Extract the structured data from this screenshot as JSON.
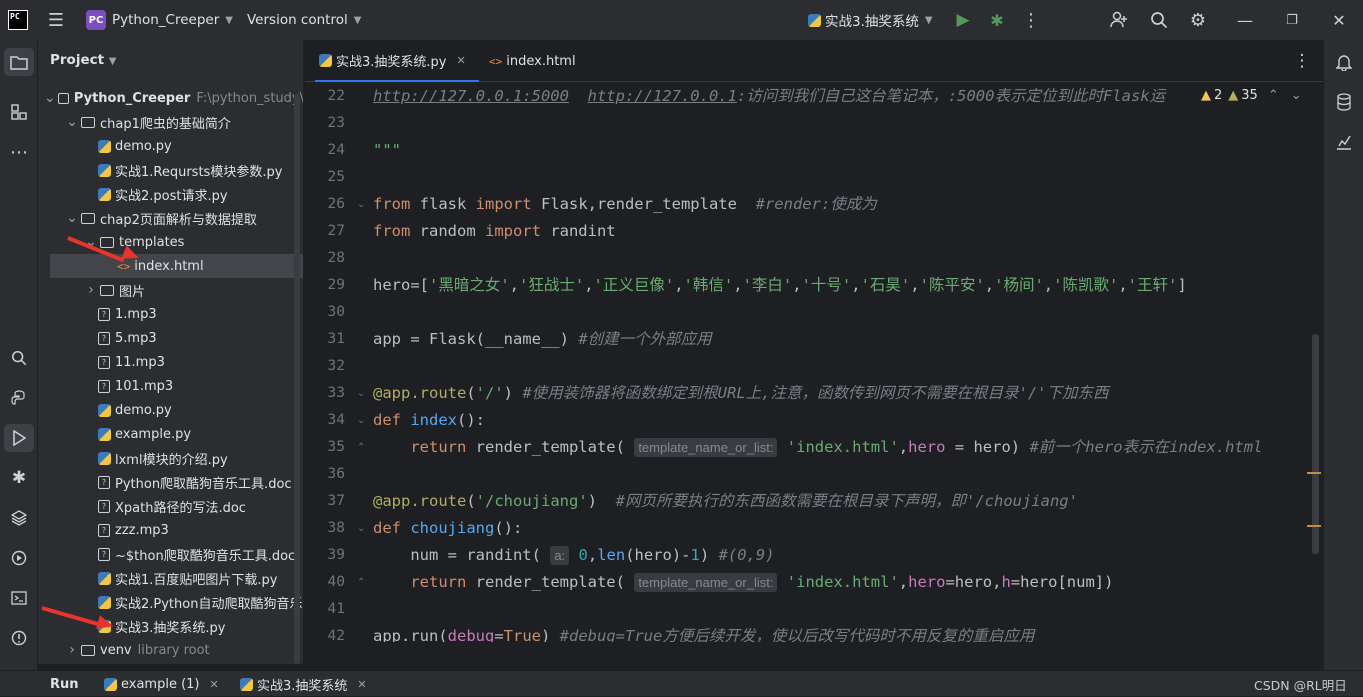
{
  "titlebar": {
    "logo_text": "PC",
    "project_badge": "PC",
    "project_name": "Python_Creeper",
    "vcs_label": "Version control",
    "run_config": "实战3.抽奖系统"
  },
  "project_panel": {
    "title": "Project",
    "tree": [
      {
        "label": "Python_Creeper",
        "extra": "F:\\python_study\\",
        "type": "folder",
        "open": true,
        "indent": 0
      },
      {
        "label": "chap1爬虫的基础简介",
        "type": "folder",
        "open": true,
        "indent": 1
      },
      {
        "label": "demo.py",
        "type": "py",
        "indent": 2
      },
      {
        "label": "实战1.Reqursts模块参数.py",
        "type": "py",
        "indent": 2
      },
      {
        "label": "实战2.post请求.py",
        "type": "py",
        "indent": 2
      },
      {
        "label": "chap2页面解析与数据提取",
        "type": "folder",
        "open": true,
        "indent": 1
      },
      {
        "label": "templates",
        "type": "folder",
        "open": true,
        "indent": 2
      },
      {
        "label": "index.html",
        "type": "html",
        "indent": 3,
        "selected": true
      },
      {
        "label": "图片",
        "type": "folder",
        "open": false,
        "indent": 2
      },
      {
        "label": "1.mp3",
        "type": "unknown",
        "indent": 2
      },
      {
        "label": "5.mp3",
        "type": "unknown",
        "indent": 2
      },
      {
        "label": "11.mp3",
        "type": "unknown",
        "indent": 2
      },
      {
        "label": "101.mp3",
        "type": "unknown",
        "indent": 2
      },
      {
        "label": "demo.py",
        "type": "py",
        "indent": 2
      },
      {
        "label": "example.py",
        "type": "py",
        "indent": 2
      },
      {
        "label": "lxml模块的介绍.py",
        "type": "py",
        "indent": 2
      },
      {
        "label": "Python爬取酷狗音乐工具.doc",
        "type": "unknown",
        "indent": 2
      },
      {
        "label": "Xpath路径的写法.doc",
        "type": "unknown",
        "indent": 2
      },
      {
        "label": "zzz.mp3",
        "type": "unknown",
        "indent": 2
      },
      {
        "label": "~$thon爬取酷狗音乐工具.doc",
        "type": "unknown",
        "indent": 2
      },
      {
        "label": "实战1.百度贴吧图片下载.py",
        "type": "py",
        "indent": 2
      },
      {
        "label": "实战2.Python自动爬取酷狗音乐",
        "type": "py",
        "indent": 2
      },
      {
        "label": "实战3.抽奖系统.py",
        "type": "py",
        "indent": 2
      },
      {
        "label": "venv",
        "extra": "library root",
        "type": "folder",
        "open": false,
        "indent": 1
      }
    ]
  },
  "editor_tabs": [
    {
      "label": "实战3.抽奖系统.py",
      "active": true
    },
    {
      "label": "index.html",
      "active": false
    }
  ],
  "inspection": {
    "warnings": "2",
    "weak_warnings": "35"
  },
  "code_lines": [
    {
      "no": "22",
      "html": "<span class=\"c u\">http://127.0.0.1:5000</span><span class=\"c\">  </span><span class=\"c u\">http://127.0.0.1</span><span class=\"c\">:访问到我们自己这台笔记本，:5000表示定位到此时Flask运</span>"
    },
    {
      "no": "23",
      "html": ""
    },
    {
      "no": "24",
      "html": "<span class=\"s\">\"\"\"</span>"
    },
    {
      "no": "25",
      "html": ""
    },
    {
      "no": "26",
      "html": "<span class=\"k\">from</span> flask <span class=\"k\">import</span> Flask,render_template  <span class=\"c\">#render:使成为</span>"
    },
    {
      "no": "27",
      "html": "<span class=\"k\">from</span> random <span class=\"k\">import</span> randint"
    },
    {
      "no": "28",
      "html": ""
    },
    {
      "no": "29",
      "html": "hero=[<span class=\"s\">'黑暗之女'</span>,<span class=\"s\">'狂战士'</span>,<span class=\"s\">'正义巨像'</span>,<span class=\"s\">'韩信'</span>,<span class=\"s\">'李白'</span>,<span class=\"s\">'十号'</span>,<span class=\"s\">'石昊'</span>,<span class=\"s\">'陈平安'</span>,<span class=\"s\">'杨间'</span>,<span class=\"s\">'陈凯歌'</span>,<span class=\"s\">'王轩'</span>]"
    },
    {
      "no": "30",
      "html": ""
    },
    {
      "no": "31",
      "html": "app = Flask(__name__) <span class=\"c\">#创建一个外部应用</span>"
    },
    {
      "no": "32",
      "html": ""
    },
    {
      "no": "33",
      "html": "<span class=\"d\">@app.route</span>(<span class=\"s\">'/'</span>) <span class=\"c\">#使用装饰器将函数绑定到根URL上,注意，函数传到网页不需要在根目录'/'下加东西</span>"
    },
    {
      "no": "34",
      "html": "<span class=\"k\">def</span> <span class=\"f\">index</span>():"
    },
    {
      "no": "35",
      "html": "    <span class=\"k\">return</span> render_template( <span class=\"hint\">template_name_or_list:</span> <span class=\"s\">'index.html'</span>,<span class=\"p\">hero</span> = hero) <span class=\"c\">#前一个hero表示在index.html</span>"
    },
    {
      "no": "36",
      "html": ""
    },
    {
      "no": "37",
      "html": "<span class=\"d\">@app.route</span>(<span class=\"s\">'/choujiang'</span>)  <span class=\"c\">#网页所要执行的东西函数需要在根目录下声明，即'/choujiang'</span>"
    },
    {
      "no": "38",
      "html": "<span class=\"k\">def</span> <span class=\"f\">choujiang</span>():"
    },
    {
      "no": "39",
      "html": "    num = randint( <span class=\"hint\">a:</span> <span class=\"n\">0</span>,<span class=\"f\">len</span>(hero)-<span class=\"n\">1</span>) <span class=\"c\">#(0,9)</span>"
    },
    {
      "no": "40",
      "html": "    <span class=\"k\">return</span> render_template( <span class=\"hint\">template_name_or_list:</span> <span class=\"s\">'index.html'</span>,<span class=\"p\">hero</span>=hero,<span class=\"p\">h</span>=hero[num])"
    },
    {
      "no": "41",
      "html": ""
    },
    {
      "no": "42",
      "html": "app.run(<span class=\"p\">debug</span>=<span class=\"k\">True</span>) <span class=\"c\">#debug=True方便后续开发，使以后改写代码时不用反复的重启应用</span>"
    }
  ],
  "bottom": {
    "run_label": "Run",
    "tabs": [
      "example (1)",
      "实战3.抽奖系统"
    ],
    "watermark": "CSDN @RL明日"
  }
}
